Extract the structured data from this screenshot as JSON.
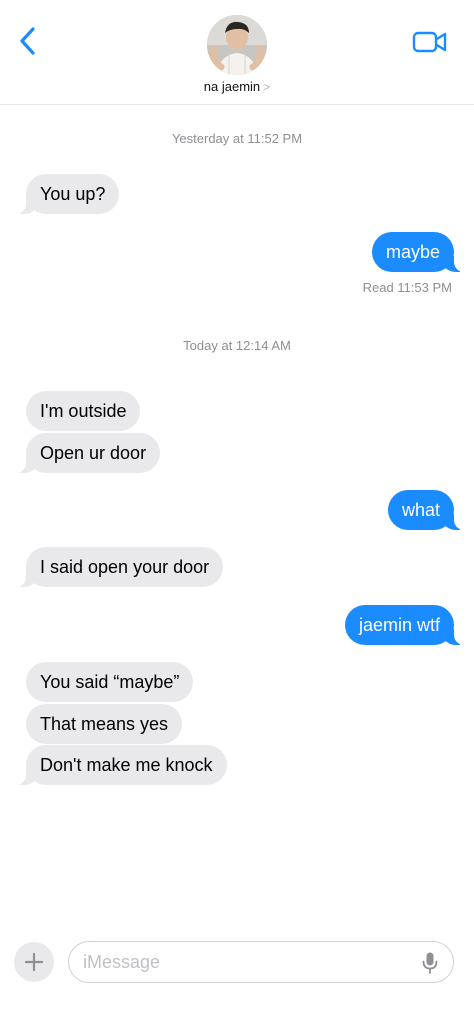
{
  "header": {
    "contact_name": "na jaemin",
    "chevron": ">",
    "back_icon": "chevron-left-icon",
    "video_icon": "video-camera-icon",
    "accent_color": "#1a8cff"
  },
  "conversation": {
    "timestamps": [
      {
        "prefix": "Yesterday",
        "time": "at 11:52 PM"
      },
      {
        "prefix": "Today",
        "time": "at 12:14 AM"
      }
    ],
    "messages": [
      {
        "sender": "them",
        "text": "You up?"
      },
      {
        "sender": "me",
        "text": "maybe"
      },
      {
        "sender": "them",
        "text": "I'm outside"
      },
      {
        "sender": "them",
        "text": "Open ur door"
      },
      {
        "sender": "me",
        "text": "what"
      },
      {
        "sender": "them",
        "text": "I said open your door"
      },
      {
        "sender": "me",
        "text": "jaemin wtf"
      },
      {
        "sender": "them",
        "text": "You said “maybe”"
      },
      {
        "sender": "them",
        "text": "That means yes"
      },
      {
        "sender": "them",
        "text": "Don't make me knock"
      }
    ],
    "read_receipt": "Read 11:53 PM"
  },
  "composer": {
    "placeholder": "iMessage",
    "plus_icon": "plus-icon",
    "mic_icon": "microphone-icon"
  }
}
